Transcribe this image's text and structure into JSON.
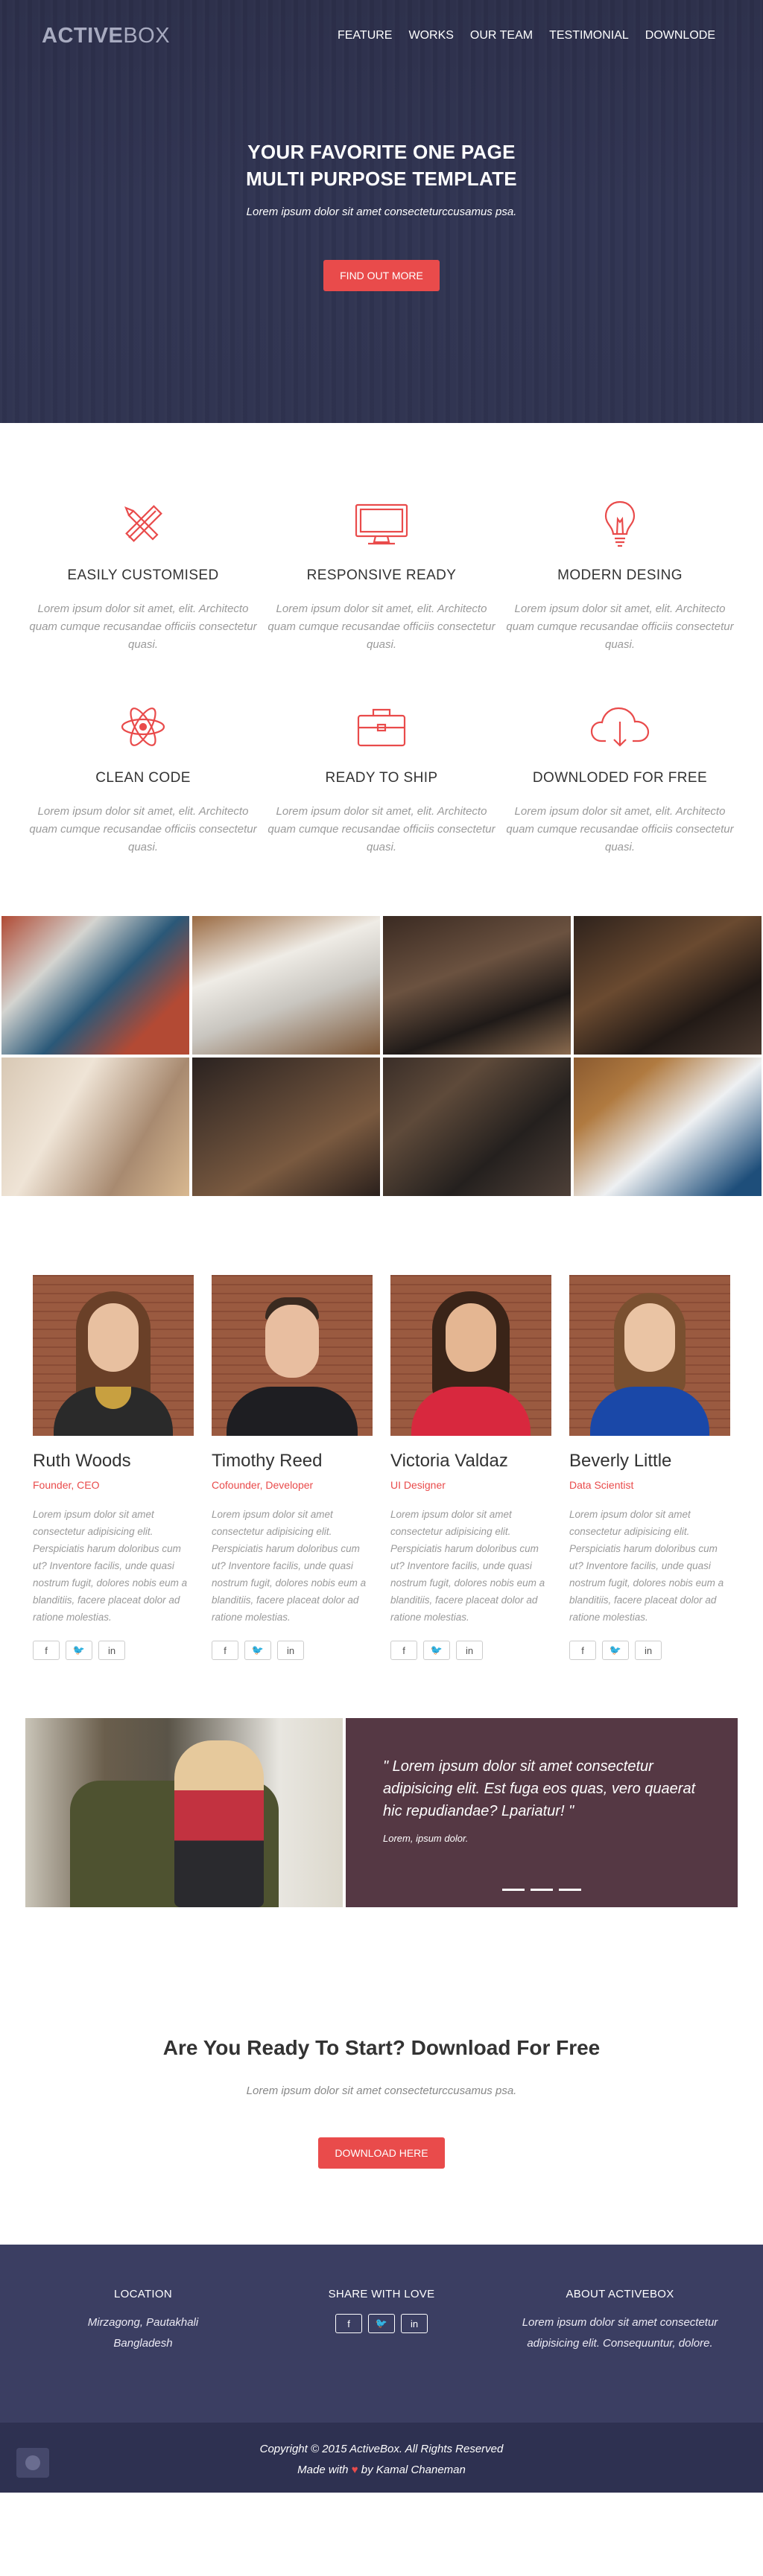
{
  "brand": {
    "logo_bold": "ACTIVE",
    "logo_light": "BOX"
  },
  "nav": {
    "items": [
      "FEATURE",
      "WORKS",
      "OUR TEAM",
      "TESTIMONIAL",
      "DOWNLODE"
    ]
  },
  "hero": {
    "title_line1": "YOUR FAVORITE ONE PAGE",
    "title_line2": "MULTI PURPOSE TEMPLATE",
    "subtitle": "Lorem ipsum dolor sit amet consecteturccusamus psa.",
    "button": "FIND OUT MORE"
  },
  "features": [
    {
      "icon": "pencil-ruler-icon",
      "title": "EASILY CUSTOMISED",
      "text": "Lorem ipsum dolor sit amet, elit. Architecto quam cumque recusandae officiis consectetur quasi."
    },
    {
      "icon": "monitor-icon",
      "title": "RESPONSIVE READY",
      "text": "Lorem ipsum dolor sit amet, elit. Architecto quam cumque recusandae officiis consectetur quasi."
    },
    {
      "icon": "lightbulb-icon",
      "title": "MODERN DESING",
      "text": "Lorem ipsum dolor sit amet, elit. Architecto quam cumque recusandae officiis consectetur quasi."
    },
    {
      "icon": "atom-icon",
      "title": "CLEAN CODE",
      "text": "Lorem ipsum dolor sit amet, elit. Architecto quam cumque recusandae officiis consectetur quasi."
    },
    {
      "icon": "briefcase-icon",
      "title": "READY TO SHIP",
      "text": "Lorem ipsum dolor sit amet, elit. Architecto quam cumque recusandae officiis consectetur quasi."
    },
    {
      "icon": "cloud-download-icon",
      "title": "DOWNLODED FOR FREE",
      "text": "Lorem ipsum dolor sit amet, elit. Architecto quam cumque recusandae officiis consectetur quasi."
    }
  ],
  "team": [
    {
      "name": "Ruth Woods",
      "role": "Founder, CEO",
      "bio": "Lorem ipsum dolor sit amet consectetur adipisicing elit. Perspiciatis harum doloribus cum ut? Inventore facilis, unde quasi nostrum fugit, dolores nobis eum a blanditiis, facere placeat dolor ad ratione molestias."
    },
    {
      "name": "Timothy Reed",
      "role": "Cofounder, Developer",
      "bio": "Lorem ipsum dolor sit amet consectetur adipisicing elit. Perspiciatis harum doloribus cum ut? Inventore facilis, unde quasi nostrum fugit, dolores nobis eum a blanditiis, facere placeat dolor ad ratione molestias."
    },
    {
      "name": "Victoria Valdaz",
      "role": "UI Designer",
      "bio": "Lorem ipsum dolor sit amet consectetur adipisicing elit. Perspiciatis harum doloribus cum ut? Inventore facilis, unde quasi nostrum fugit, dolores nobis eum a blanditiis, facere placeat dolor ad ratione molestias."
    },
    {
      "name": "Beverly Little",
      "role": "Data Scientist",
      "bio": "Lorem ipsum dolor sit amet consectetur adipisicing elit. Perspiciatis harum doloribus cum ut? Inventore facilis, unde quasi nostrum fugit, dolores nobis eum a blanditiis, facere placeat dolor ad ratione molestias."
    }
  ],
  "social_glyphs": {
    "facebook": "f",
    "twitter": "🐦",
    "linkedin": "in"
  },
  "testimonial": {
    "quote": "\" Lorem ipsum dolor sit amet consectetur adipisicing elit. Est fuga eos quas, vero quaerat hic repudiandae? Lpariatur! \"",
    "author": "Lorem, ipsum dolor."
  },
  "cta": {
    "title": "Are You Ready To Start? Download For Free",
    "subtitle": "Lorem ipsum dolor sit amet consecteturccusamus psa.",
    "button": "DOWNLOAD HERE"
  },
  "footer": {
    "location_heading": "LOCATION",
    "location_line1": "Mirzagong, Pautakhali",
    "location_line2": "Bangladesh",
    "share_heading": "SHARE WITH LOVE",
    "about_heading": "ABOUT ACTIVEBOX",
    "about_text": "Lorem ipsum dolor sit amet consectetur adipisicing elit. Consequuntur, dolore.",
    "copyright": "Copyright © 2015 ActiveBox. All Rights Reserved",
    "made_with_prefix": "Made with",
    "made_with_suffix": "by Kamal Chaneman"
  },
  "colors": {
    "accent": "#e94b4b",
    "hero_bg": "#2f3350",
    "footer_bg": "#3b3e62",
    "quote_bg": "#553844"
  }
}
